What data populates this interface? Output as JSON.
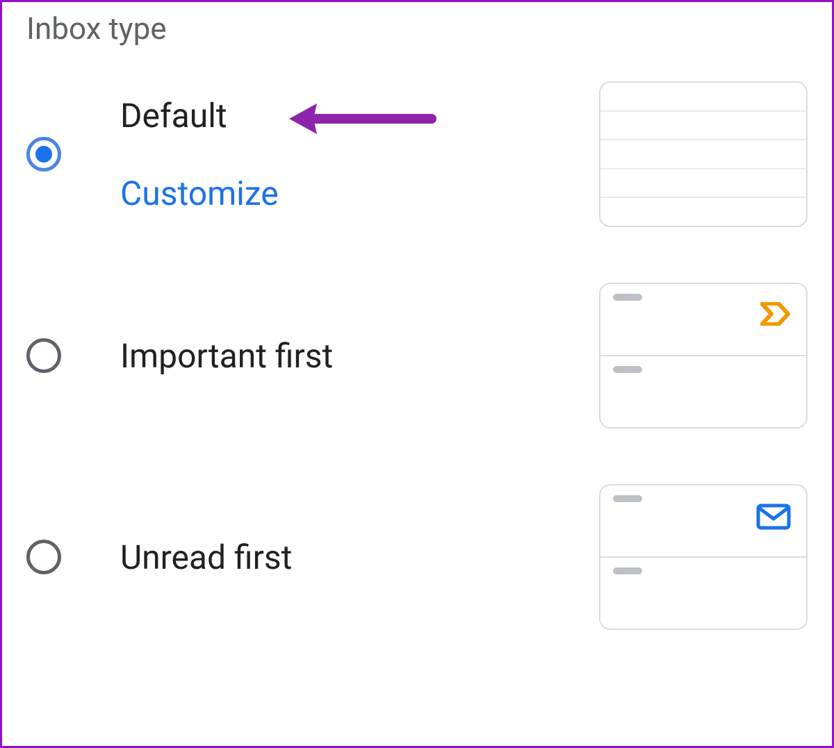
{
  "section_title": "Inbox type",
  "options": [
    {
      "label": "Default",
      "customize_label": "Customize",
      "selected": true
    },
    {
      "label": "Important first",
      "selected": false
    },
    {
      "label": "Unread first",
      "selected": false
    }
  ],
  "colors": {
    "accent": "#1a73e8",
    "important_marker": "#f29900",
    "annotation": "#8e24aa",
    "border": "#dadce0"
  }
}
